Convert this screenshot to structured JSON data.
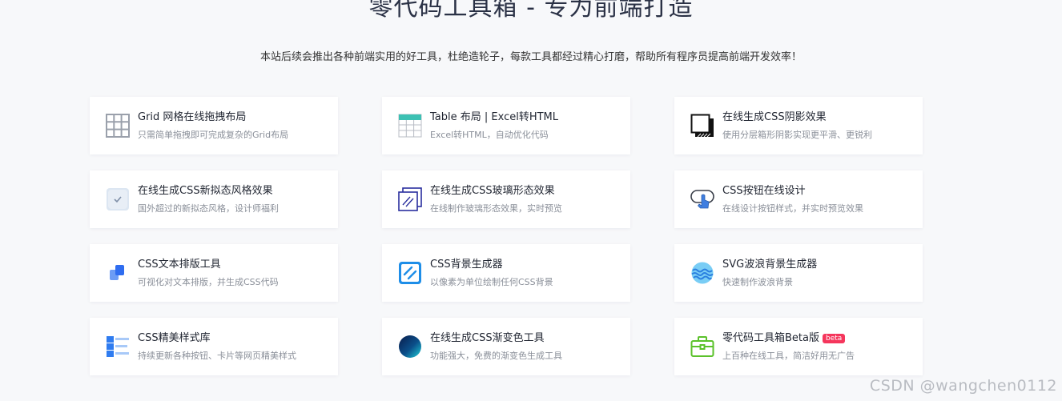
{
  "header": {
    "title": "零代码工具箱 - 专为前端打造",
    "subtitle": "本站后续会推出各种前端实用的好工具，杜绝造轮子，每款工具都经过精心打磨，帮助所有程序员提高前端开发效率！"
  },
  "tools": [
    {
      "name": "Grid 网格在线拖拽布局",
      "desc": "只需简单拖拽即可完成复杂的Grid布局",
      "icon": "grid-icon"
    },
    {
      "name": "Table 布局 | Excel转HTML",
      "desc": "Excel转HTML，自动优化代码",
      "icon": "table-icon"
    },
    {
      "name": "在线生成CSS阴影效果",
      "desc": "使用分层箱形阴影实现更平滑、更锐利",
      "icon": "shadow-icon"
    },
    {
      "name": "在线生成CSS新拟态风格效果",
      "desc": "国外超过的新拟态风格，设计师福利",
      "icon": "neumorphism-icon"
    },
    {
      "name": "在线生成CSS玻璃形态效果",
      "desc": "在线制作玻璃形态效果，实时预览",
      "icon": "glass-icon"
    },
    {
      "name": "CSS按钮在线设计",
      "desc": "在线设计按钮样式，并实时预览效果",
      "icon": "button-click-icon"
    },
    {
      "name": "CSS文本排版工具",
      "desc": "可视化对文本排版，并生成CSS代码",
      "icon": "text-layout-icon"
    },
    {
      "name": "CSS背景生成器",
      "desc": "以像素为单位绘制任何CSS背景",
      "icon": "pattern-icon"
    },
    {
      "name": "SVG波浪背景生成器",
      "desc": "快速制作波浪背景",
      "icon": "wave-icon"
    },
    {
      "name": "CSS精美样式库",
      "desc": "持续更新各种按钮、卡片等网页精美样式",
      "icon": "style-list-icon"
    },
    {
      "name": "在线生成CSS渐变色工具",
      "desc": "功能强大，免费的渐变色生成工具",
      "icon": "gradient-icon"
    },
    {
      "name": "零代码工具箱Beta版",
      "desc": "上百种在线工具，简洁好用无广告",
      "icon": "toolbox-icon",
      "badge": "beta"
    }
  ],
  "watermark": "CSDN @wangchen0112"
}
